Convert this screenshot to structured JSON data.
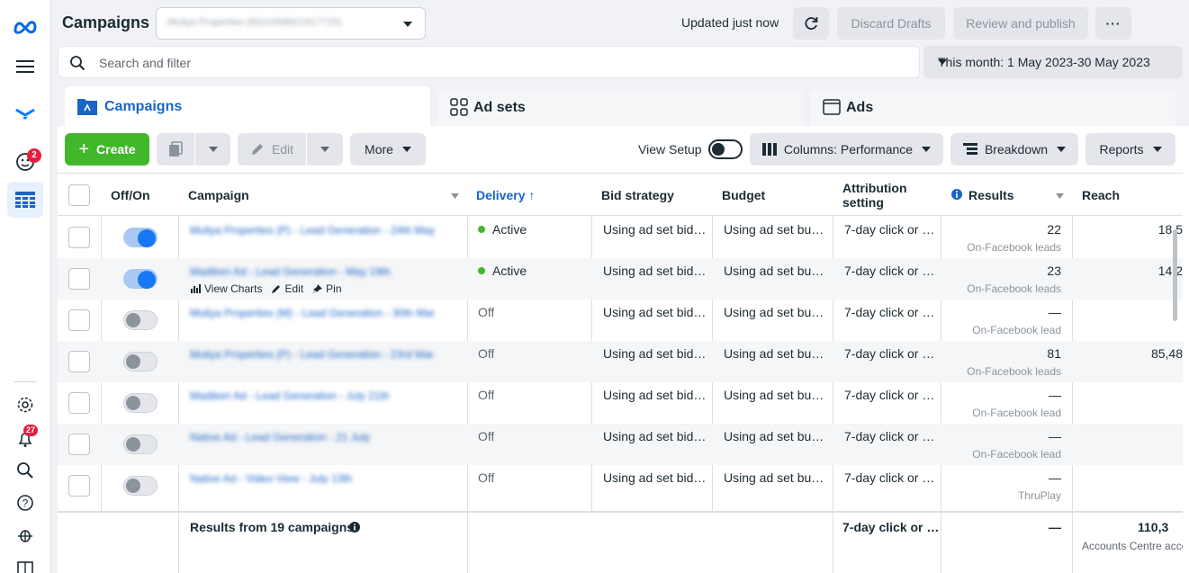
{
  "header": {
    "title": "Campaigns",
    "account_name": "Muliya Properties (6521658821917725)",
    "updated_text": "Updated just now",
    "discard_label": "Discard Drafts",
    "review_label": "Review and publish",
    "more_dots": "···"
  },
  "search": {
    "placeholder": "Search and filter",
    "date_range": "This month: 1 May 2023-30 May 2023"
  },
  "tabs": [
    {
      "label": "Campaigns",
      "active": true
    },
    {
      "label": "Ad sets",
      "active": false
    },
    {
      "label": "Ads",
      "active": false
    }
  ],
  "toolbar": {
    "create_label": "Create",
    "edit_label": "Edit",
    "more_label": "More",
    "view_setup_label": "View Setup",
    "columns_label": "Columns: Performance",
    "breakdown_label": "Breakdown",
    "reports_label": "Reports"
  },
  "rail": {
    "notifications_badge": "2",
    "alerts_badge": "27"
  },
  "table": {
    "columns": {
      "off_on": "Off/On",
      "campaign": "Campaign",
      "delivery": "Delivery ↑",
      "bid_strategy": "Bid strategy",
      "budget": "Budget",
      "attribution": "Attribution setting",
      "results": "Results",
      "reach": "Reach"
    },
    "row_actions": {
      "view_charts": "View Charts",
      "edit": "Edit",
      "pin": "Pin"
    },
    "rows": [
      {
        "name": "Muliya Properties (P) - Lead Generation - 24th May",
        "on": true,
        "delivery": "Active",
        "bid": "Using ad set bid…",
        "budget": "Using ad set bu…",
        "attribution": "7-day click or …",
        "result": "22",
        "result_type": "On-Facebook leads",
        "reach": "18,5"
      },
      {
        "name": "Madikeri Ad - Lead Generation - May 19th",
        "on": true,
        "delivery": "Active",
        "bid": "Using ad set bid…",
        "budget": "Using ad set bu…",
        "attribution": "7-day click or …",
        "result": "23",
        "result_type": "On-Facebook leads",
        "reach": "14,2"
      },
      {
        "name": "Muliya Properties (M) - Lead Generation - 30th Mar",
        "on": false,
        "delivery": "Off",
        "bid": "Using ad set bid…",
        "budget": "Using ad set bu…",
        "attribution": "7-day click or …",
        "result": "—",
        "result_type": "On-Facebook lead",
        "reach": ""
      },
      {
        "name": "Muliya Properties (P) - Lead Generation - 23rd Mar",
        "on": false,
        "delivery": "Off",
        "bid": "Using ad set bid…",
        "budget": "Using ad set bu…",
        "attribution": "7-day click or …",
        "result": "81",
        "result_type": "On-Facebook leads",
        "reach": "85,48"
      },
      {
        "name": "Madikeri Ad - Lead Generation - July 21th",
        "on": false,
        "delivery": "Off",
        "bid": "Using ad set bid…",
        "budget": "Using ad set bu…",
        "attribution": "7-day click or …",
        "result": "—",
        "result_type": "On-Facebook lead",
        "reach": ""
      },
      {
        "name": "Native Ad - Lead Generation - 21 July",
        "on": false,
        "delivery": "Off",
        "bid": "Using ad set bid…",
        "budget": "Using ad set bu…",
        "attribution": "7-day click or …",
        "result": "—",
        "result_type": "On-Facebook lead",
        "reach": ""
      },
      {
        "name": "Native Ad - Video View - July 13th",
        "on": false,
        "delivery": "Off",
        "bid": "Using ad set bid…",
        "budget": "Using ad set bu…",
        "attribution": "7-day click or …",
        "result": "—",
        "result_type": "ThruPlay",
        "reach": ""
      }
    ],
    "footer": {
      "summary": "Results from 19 campaigns",
      "attribution": "7-day click or …",
      "result": "—",
      "reach": "110,3",
      "reach_sub": "Accounts Centre acco"
    }
  },
  "colors": {
    "accent": "#1a64c8",
    "create": "#42b72a",
    "active_dot": "#42b72a",
    "badge": "#e41e3f"
  }
}
